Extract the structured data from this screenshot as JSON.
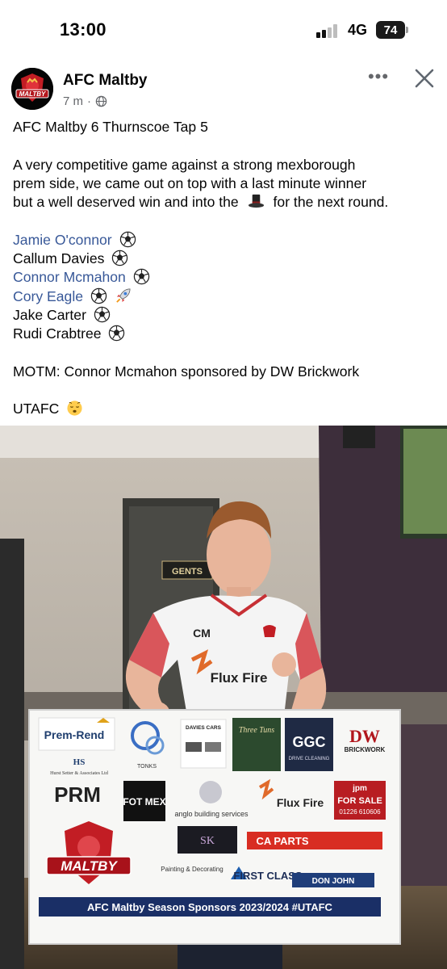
{
  "status_bar": {
    "time": "13:00",
    "network": "4G",
    "battery": "74"
  },
  "post": {
    "page_name": "AFC Maltby",
    "time_ago": "7 m",
    "separator": "·",
    "more_label": "•••",
    "avatar_logo_text": "MALTBY",
    "headline": "AFC Maltby 6 Thurnscoe Tap 5",
    "body_lines": [
      "A very competitive game against a strong mexborough",
      "prem side, we came out on top with a last minute winner",
      "but a well deserved win and into the",
      "for the next round."
    ],
    "scorers": [
      {
        "name": "Jamie O'connor",
        "mention": true
      },
      {
        "name": "Callum Davies",
        "mention": false
      },
      {
        "name": "Connor Mcmahon",
        "mention": true
      },
      {
        "name": "Cory Eagle",
        "mention": true
      },
      {
        "name": "Jake Carter",
        "mention": false
      },
      {
        "name": "Rudi Crabtree",
        "mention": false
      }
    ],
    "motm": "MOTM: Connor Mcmahon sponsored by DW Brickwork",
    "signoff": "UTAFC"
  },
  "photo": {
    "door_sign": "GENTS",
    "shirt_initials": "CM",
    "shirt_sponsor": "Flux Fire",
    "board_footer": "AFC Maltby Season Sponsors 2023/2024 #UTAFC",
    "board_logo": "MALTBY",
    "sponsors": {
      "prem_rend": "Prem-Rend",
      "hurst": "HS",
      "hurst_name": "Hurst Setter & Associates Ltd",
      "tonks": "TONKS",
      "davies_cars": "DAVIES CARS",
      "three_tuns": "Three Tuns",
      "ggc": "GGC",
      "ggc_sub": "DRIVE CLEANING",
      "dw_brickwork": "DW",
      "dw_sub": "BRICKWORK",
      "prm": "PRM",
      "fotmex": "FOT MEX",
      "anglo": "anglo building services",
      "flux_fire": "Flux Fire",
      "jpm": "jpm",
      "jpm_sale": "FOR SALE",
      "jpm_phone": "01226 610606",
      "ca_parts": "CA PARTS",
      "painting": "Painting & Decorating",
      "first_class": "FIRST CLASS",
      "don_john": "DON JOHN"
    }
  }
}
